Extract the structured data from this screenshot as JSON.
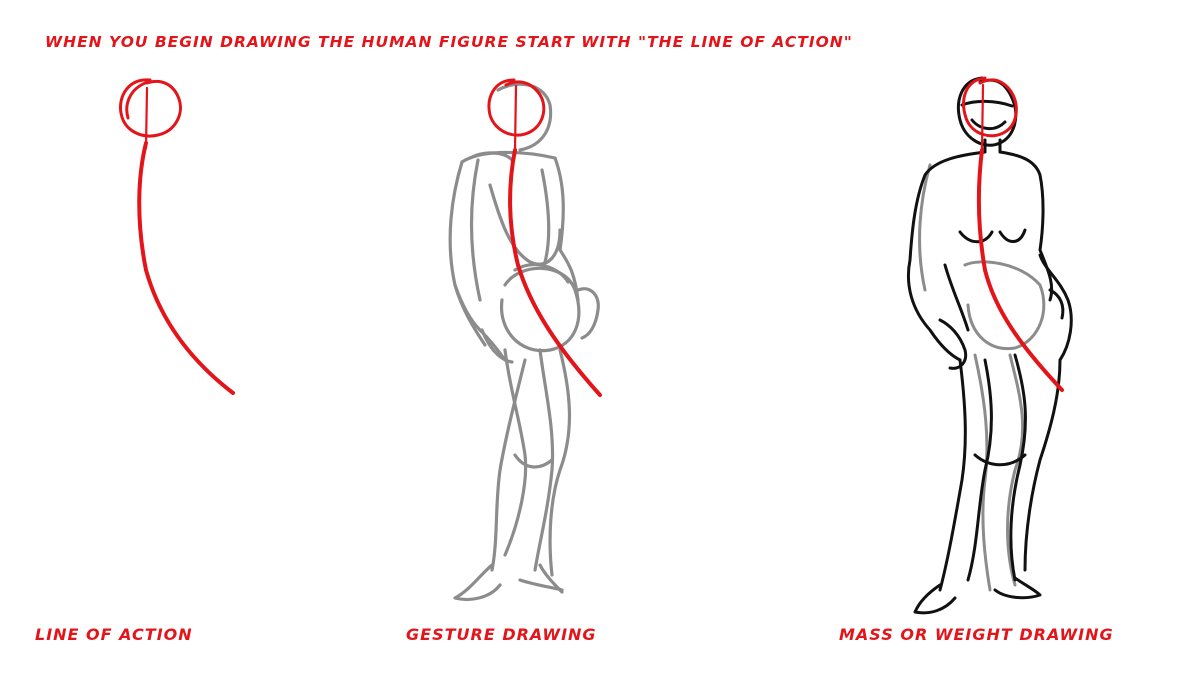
{
  "heading": "WHEN YOU BEGIN DRAWING THE HUMAN FIGURE START WITH \"THE LINE OF ACTION\"",
  "labels": {
    "line_of_action": "LINE OF ACTION",
    "gesture_drawing": "GESTURE  DRAWING",
    "mass_drawing": "MASS OR WEIGHT DRAWING"
  },
  "colors": {
    "accent_red": "#e3151a",
    "gesture_gray": "#8c8c8c",
    "ink_black": "#111111",
    "background": "#ffffff"
  }
}
